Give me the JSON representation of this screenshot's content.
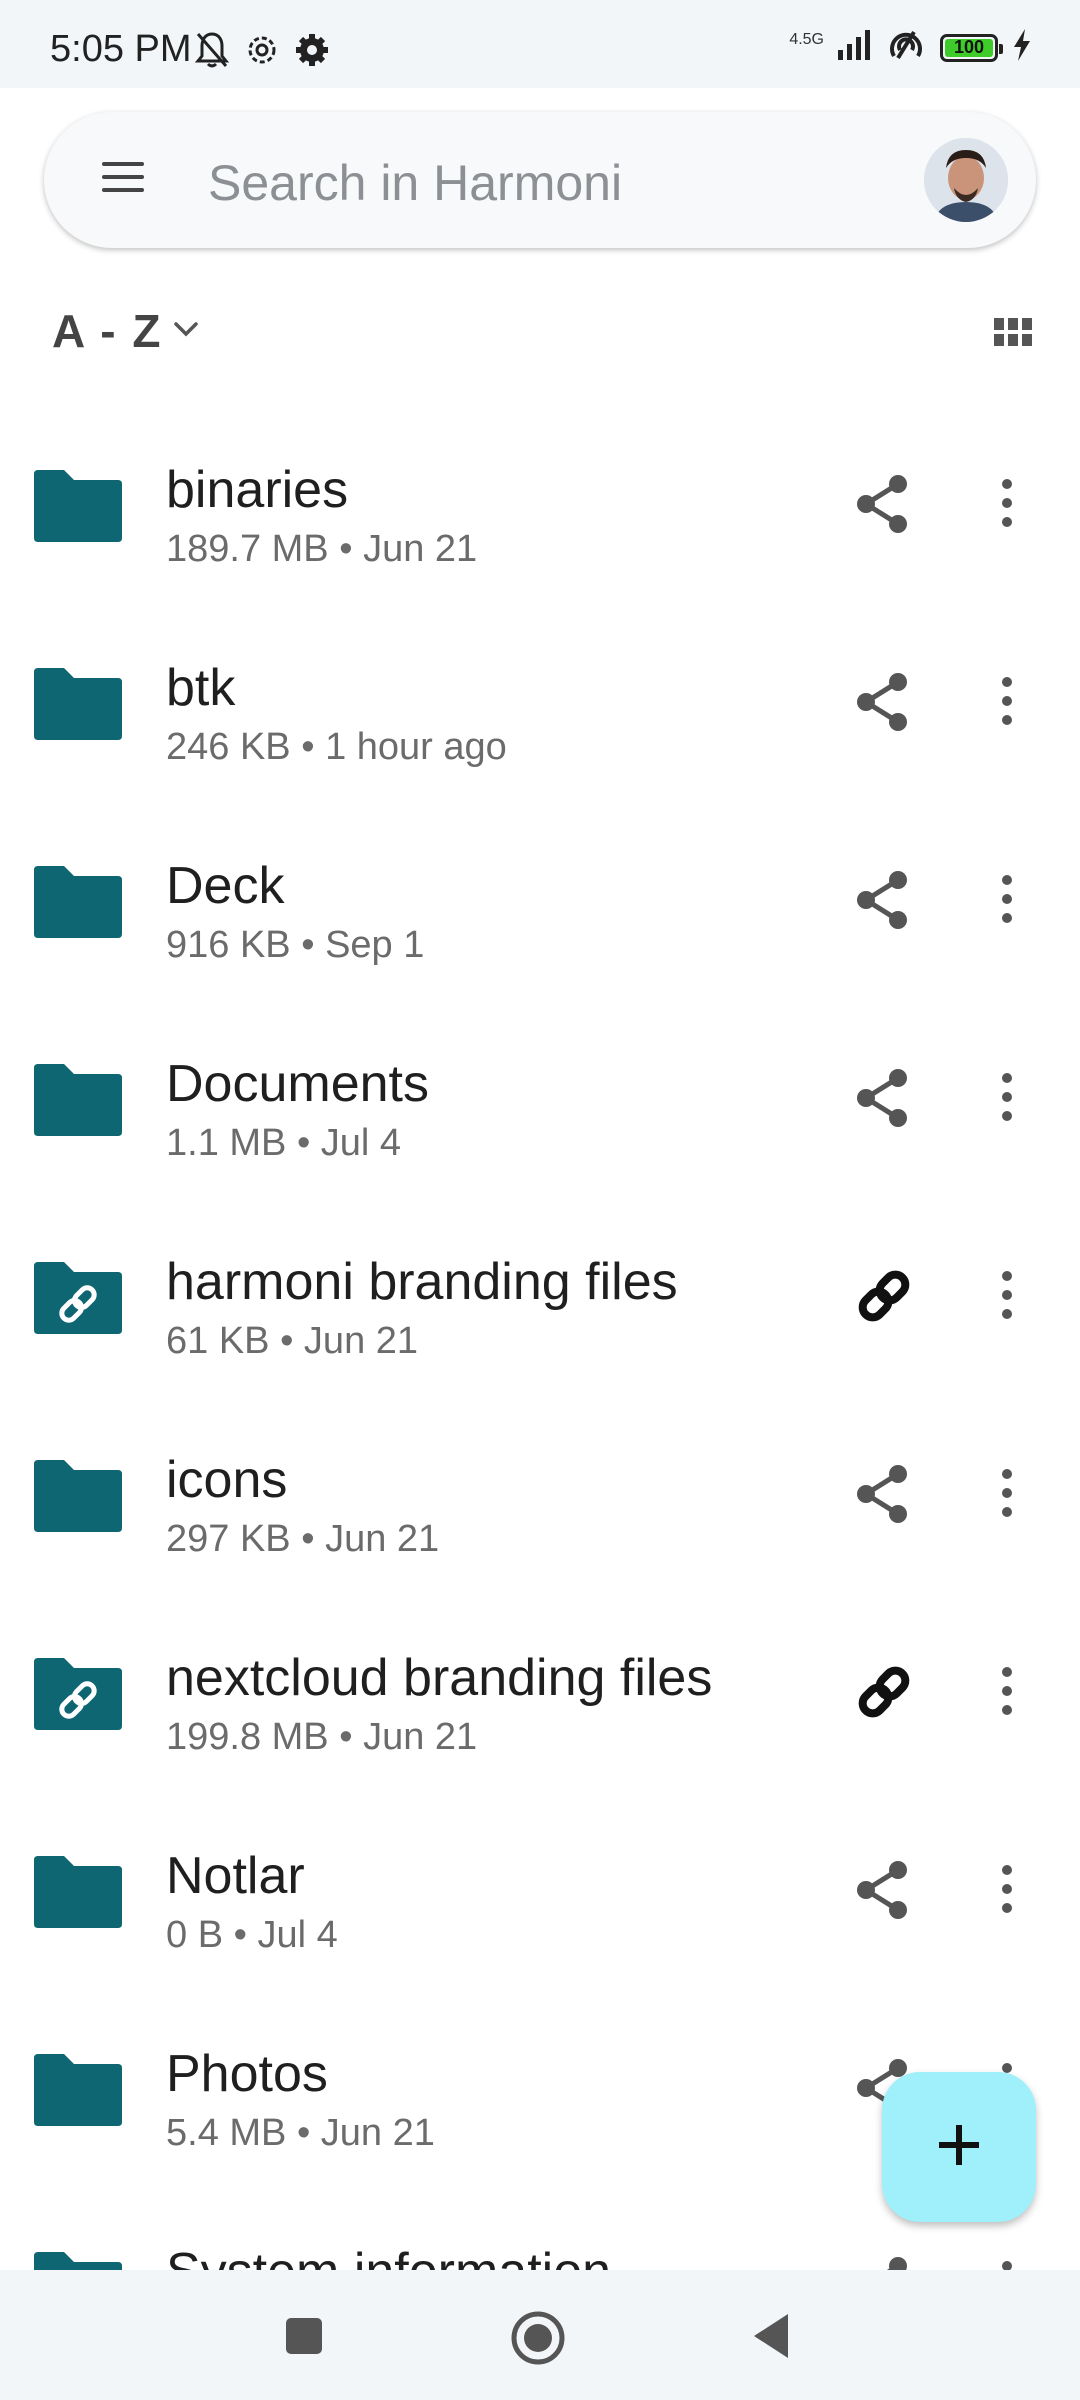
{
  "status_bar": {
    "time": "5:05 PM",
    "network_type": "4.5G",
    "battery": "100",
    "battery_level_percent": 100,
    "icons": [
      "bell-off-icon",
      "settings-cog-icon",
      "gear-icon",
      "signal-icon",
      "hotspot-icon",
      "battery-icon",
      "charging-icon"
    ]
  },
  "search": {
    "placeholder": "Search in Harmoni",
    "menu_icon": "hamburger-menu-icon",
    "avatar_icon": "user-avatar"
  },
  "sort": {
    "label": "A - Z",
    "chevron_icon": "chevron-down-icon",
    "view_toggle_icon": "grid-view-icon"
  },
  "files": [
    {
      "name": "binaries",
      "meta": "189.7 MB • Jun 21",
      "icon": "folder-icon",
      "action_icon": "share-icon"
    },
    {
      "name": "btk",
      "meta": "246 KB • 1 hour ago",
      "icon": "folder-icon",
      "action_icon": "share-icon"
    },
    {
      "name": "Deck",
      "meta": "916 KB • Sep 1",
      "icon": "folder-icon",
      "action_icon": "share-icon"
    },
    {
      "name": "Documents",
      "meta": "1.1 MB • Jul 4",
      "icon": "folder-icon",
      "action_icon": "share-icon"
    },
    {
      "name": "harmoni branding files",
      "meta": "61 KB • Jun 21",
      "icon": "shared-link-folder-icon",
      "action_icon": "link-icon"
    },
    {
      "name": "icons",
      "meta": "297 KB • Jun 21",
      "icon": "folder-icon",
      "action_icon": "share-icon"
    },
    {
      "name": "nextcloud branding files",
      "meta": "199.8 MB • Jun 21",
      "icon": "shared-link-folder-icon",
      "action_icon": "link-icon"
    },
    {
      "name": "Notlar",
      "meta": "0 B • Jul 4",
      "icon": "folder-icon",
      "action_icon": "share-icon"
    },
    {
      "name": "Photos",
      "meta": "5.4 MB • Jun 21",
      "icon": "folder-icon",
      "action_icon": "share-icon"
    },
    {
      "name": "System information",
      "meta": "",
      "icon": "folder-icon",
      "action_icon": "share-icon"
    }
  ],
  "fab": {
    "icon": "plus-icon"
  },
  "nav": {
    "icons": [
      "recent-apps-icon",
      "home-icon",
      "back-icon"
    ]
  },
  "colors": {
    "folder": "#0e6673",
    "fab": "#9ff0fb",
    "bars": "#f3f6f9",
    "battery_fill": "#3fcc2a"
  }
}
